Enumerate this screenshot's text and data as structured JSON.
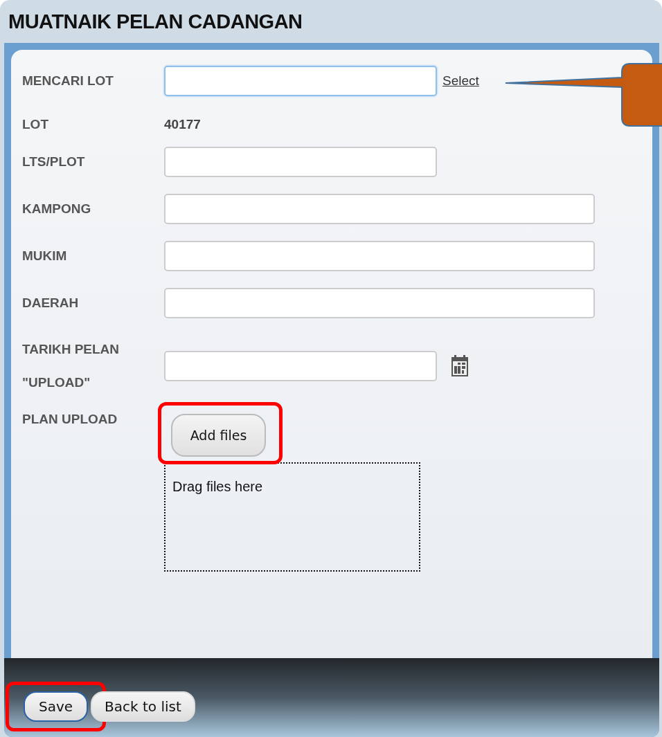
{
  "title": "MUATNAIK PELAN CADANGAN",
  "fields": [
    {
      "kind": "search",
      "label": "MENCARI LOT",
      "focused": true,
      "link": "Select"
    },
    {
      "kind": "text",
      "label": "LOT",
      "value": "40177"
    },
    {
      "kind": "short-input",
      "label": "LTS/PLOT"
    },
    {
      "kind": "input",
      "label": "KAMPONG"
    },
    {
      "kind": "input",
      "label": "MUKIM"
    },
    {
      "kind": "input",
      "label": "DAERAH"
    },
    {
      "kind": "date",
      "label": "TARIKH PELAN \"UPLOAD\""
    },
    {
      "kind": "upload",
      "label": "PLAN UPLOAD",
      "button": "Add files",
      "dropzone": "Drag files here",
      "highlighted": true
    }
  ],
  "buttons": [
    {
      "label": "Save",
      "highlighted": true,
      "focused": true
    },
    {
      "label": "Back to list",
      "highlighted": false,
      "focused": false
    }
  ]
}
